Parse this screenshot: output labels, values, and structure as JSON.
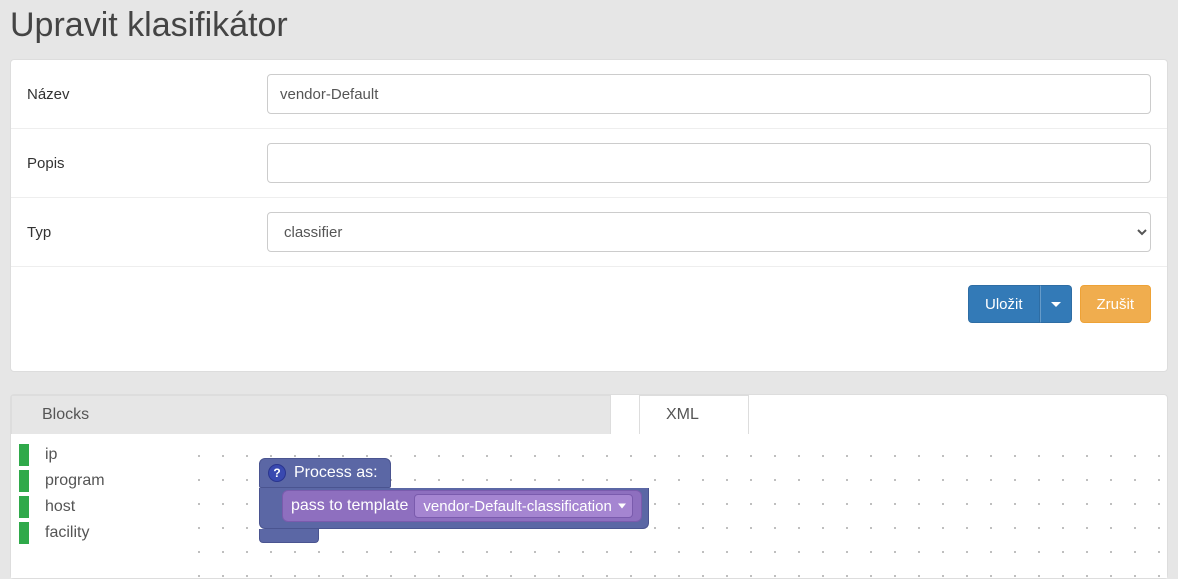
{
  "page_title": "Upravit klasifikátor",
  "form": {
    "name_label": "Název",
    "name_value": "vendor-Default",
    "desc_label": "Popis",
    "desc_value": "",
    "type_label": "Typ",
    "type_value": "classifier"
  },
  "buttons": {
    "save": "Uložit",
    "cancel": "Zrušit"
  },
  "tabs": {
    "blocks": "Blocks",
    "xml": "XML"
  },
  "block_categories": [
    "ip",
    "program",
    "host",
    "facility"
  ],
  "block": {
    "head": "Process as:",
    "help_char": "?",
    "inner_label": "pass to template",
    "dropdown_value": "vendor-Default-classification"
  }
}
